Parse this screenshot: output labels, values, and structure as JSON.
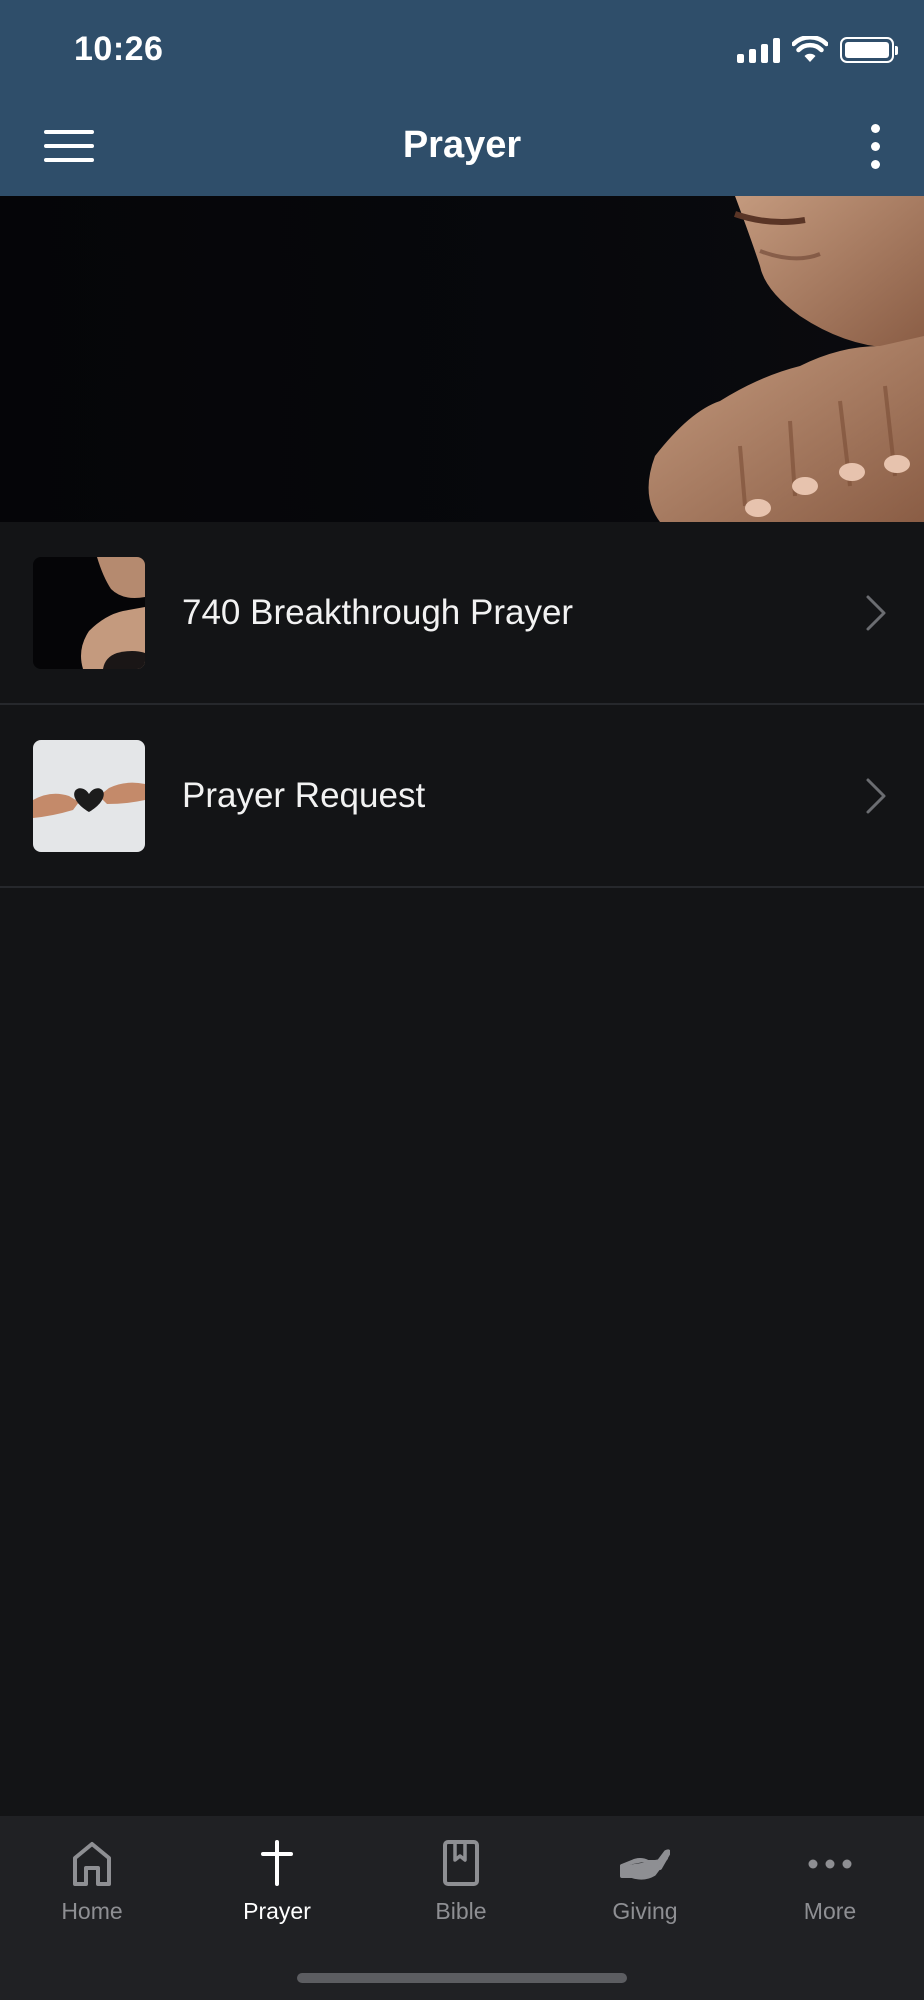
{
  "status_bar": {
    "time": "10:26"
  },
  "header": {
    "title": "Prayer",
    "bg_color": "#2f4e6a",
    "menu_icon": "hamburger-icon",
    "more_icon": "kebab-icon"
  },
  "hero": {
    "image": "praying-hands-photo"
  },
  "list": {
    "items": [
      {
        "label": "740 Breakthrough Prayer",
        "thumbnail": "praying-hands-thumbnail"
      },
      {
        "label": "Prayer Request",
        "thumbnail": "hands-heart-thumbnail"
      }
    ]
  },
  "bottom_nav": {
    "active": "Prayer",
    "items": [
      {
        "label": "Home",
        "icon": "home-icon"
      },
      {
        "label": "Prayer",
        "icon": "cross-icon"
      },
      {
        "label": "Bible",
        "icon": "bible-icon"
      },
      {
        "label": "Giving",
        "icon": "giving-hand-icon"
      },
      {
        "label": "More",
        "icon": "more-dots-icon"
      }
    ]
  }
}
